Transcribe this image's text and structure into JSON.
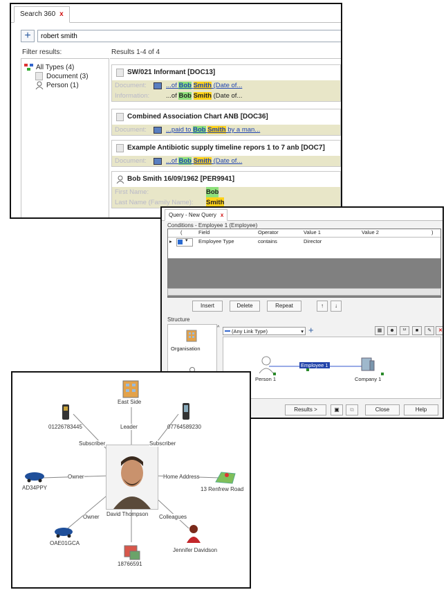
{
  "search360": {
    "tab_label": "Search 360",
    "close_glyph": "x",
    "add_glyph": "+",
    "query_value": "robert smith",
    "filter_heading": "Filter results:",
    "results_heading": "Results 1-4 of 4",
    "filters": [
      {
        "label": "All Types (4)",
        "icon": "all-types-icon"
      },
      {
        "label": "Document (3)",
        "icon": "document-icon"
      },
      {
        "label": "Person (1)",
        "icon": "person-icon"
      }
    ],
    "results": [
      {
        "title": "SW/021 Informant [DOC13]",
        "rows": [
          {
            "field": "Document:",
            "pre": "...of ",
            "h1": "Bob",
            "h2": "Smith",
            "post": " (Date of...",
            "link": true
          },
          {
            "field": "Information:",
            "pre": "...of ",
            "h1": "Bob",
            "h2": "Smith",
            "post": " (Date of...",
            "link": false
          }
        ]
      },
      {
        "title": "Combined Association Chart ANB [DOC36]",
        "rows": [
          {
            "field": "Document:",
            "pre": "...paid to ",
            "h1": "Bob",
            "h2": "Smith",
            "post": " by a man...",
            "link": true
          }
        ]
      },
      {
        "title": "Example Antibiotic supply timeline repors 1 to 7 anb [DOC7]",
        "rows": [
          {
            "field": "Document:",
            "pre": "...of ",
            "h1": "Bob",
            "h2": "Smith",
            "post": " (Date of...",
            "link": true
          }
        ]
      },
      {
        "title": "Bob Smith 16/09/1962 [PER9941]",
        "person_rows": [
          {
            "field": "First Name:",
            "value": "Bob"
          },
          {
            "field": "Last Name (Family Name):",
            "value": "Smith"
          }
        ]
      }
    ]
  },
  "query": {
    "tab_label": "Query - New Query",
    "conditions_label": "Conditions - Employee 1 (Employee)",
    "columns": [
      "Field",
      "Operator",
      "Value 1",
      "Value 2"
    ],
    "row": {
      "field": "Employee Type",
      "operator": "contains",
      "value1": "Director",
      "value2": ""
    },
    "buttons": {
      "insert": "Insert",
      "delete": "Delete",
      "repeat": "Repeat",
      "up": "↑",
      "down": "↓"
    },
    "structure_label": "Structure",
    "link_type": "(Any Link Type)",
    "organisation_label": "Organisation",
    "person_node": "Person 1",
    "employee_node": "Employee 1",
    "company_node": "Company 1",
    "footer": {
      "results": "Results >",
      "close": "Close",
      "help": "Help"
    }
  },
  "graph": {
    "center": "David Thompson",
    "nodes": {
      "east_side": "East Side",
      "phone1": "01226783445",
      "phone2": "07764589230",
      "car1": "AD34PPY",
      "address": "13 Renfrew Road",
      "car2": "OAE01GCA",
      "person": "Jennifer Davidson",
      "account": "18766591"
    },
    "edges": {
      "leader": "Leader",
      "subscriber1": "Subscriber",
      "subscriber2": "Subscriber",
      "owner1": "Owner",
      "home_address": "Home Address",
      "owner2": "Owner",
      "colleagues": "Colleagues"
    }
  }
}
